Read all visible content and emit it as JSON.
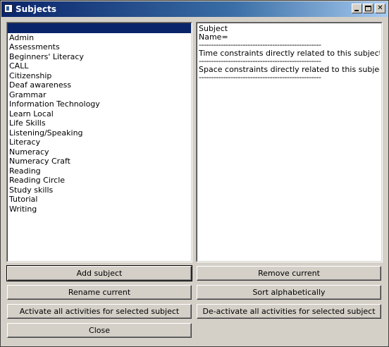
{
  "window": {
    "title": "Subjects",
    "controls": {
      "minimize": "minimize",
      "maximize": "maximize",
      "close": "✕"
    }
  },
  "subjects": {
    "items": [
      "",
      "Admin",
      "Assessments",
      "Beginners' Literacy",
      "CALL",
      "Citizenship",
      "Deaf awareness",
      "Grammar",
      "Information Technology",
      "Learn Local",
      "Life Skills",
      "Listening/Speaking",
      "Literacy",
      "Numeracy",
      "Numeracy Craft",
      "Reading",
      "Reading Circle",
      "Study skills",
      "Tutorial",
      "Writing"
    ],
    "selected_index": 0
  },
  "details": {
    "lines": [
      "Subject",
      "Name=",
      "--------------------------------------------------",
      "Time constraints directly related to this subject:",
      "--------------------------------------------------",
      "Space constraints directly related to this subject:",
      "--------------------------------------------------"
    ]
  },
  "buttons": {
    "add_subject": "Add subject",
    "remove_current": "Remove current",
    "rename_current": "Rename current",
    "sort_alphabetically": "Sort alphabetically",
    "activate_all": "Activate all activities for selected subject",
    "deactivate_all": "De-activate all activities for selected subject",
    "close": "Close"
  }
}
